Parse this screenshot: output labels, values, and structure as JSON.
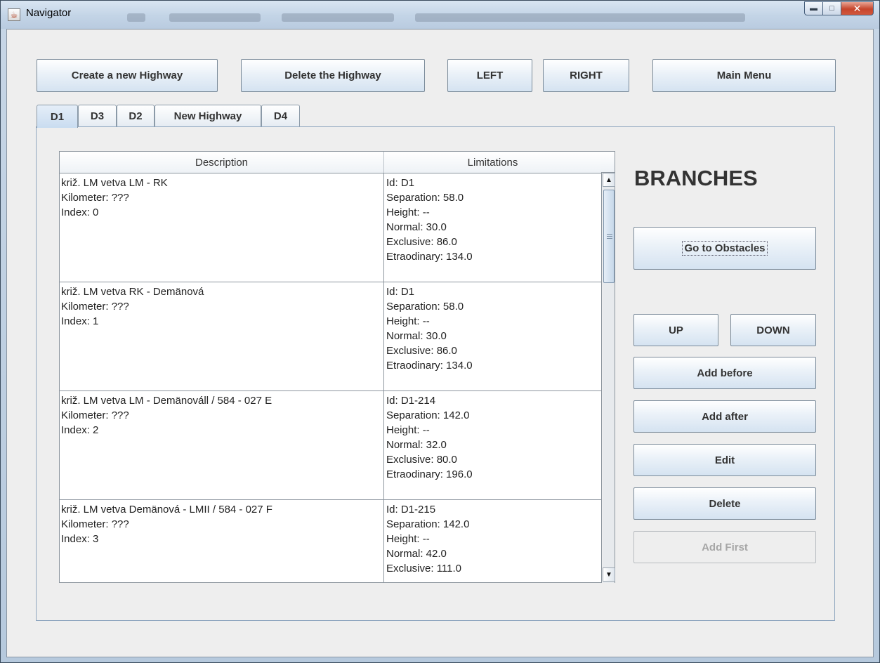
{
  "window": {
    "title": "Navigator"
  },
  "toolbar": {
    "create_label": "Create a new Highway",
    "delete_label": "Delete the Highway",
    "left_label": "LEFT",
    "right_label": "RIGHT",
    "main_menu_label": "Main Menu"
  },
  "tabs": [
    {
      "label": "D1",
      "selected": true
    },
    {
      "label": "D3",
      "selected": false
    },
    {
      "label": "D2",
      "selected": false
    },
    {
      "label": "New Highway",
      "selected": false
    },
    {
      "label": "D4",
      "selected": false
    }
  ],
  "table": {
    "columns": [
      "Description",
      "Limitations"
    ],
    "rows": [
      {
        "description": [
          "križ. LM vetva LM - RK",
          "Kilometer: ???",
          "Index: 0"
        ],
        "limitations": [
          "Id: D1",
          "Separation: 58.0",
          "Height: --",
          "Normal: 30.0",
          "Exclusive: 86.0",
          "Etraodinary: 134.0"
        ]
      },
      {
        "description": [
          "križ. LM vetva RK - Demänová",
          "Kilometer: ???",
          "Index: 1"
        ],
        "limitations": [
          "Id: D1",
          "Separation: 58.0",
          "Height: --",
          "Normal: 30.0",
          "Exclusive: 86.0",
          "Etraodinary: 134.0"
        ]
      },
      {
        "description": [
          "križ. LM vetva LM - Demänováll / 584 - 027 E",
          "Kilometer: ???",
          "Index: 2"
        ],
        "limitations": [
          "Id: D1-214",
          "Separation: 142.0",
          "Height: --",
          "Normal: 32.0",
          "Exclusive: 80.0",
          "Etraodinary: 196.0"
        ]
      },
      {
        "description": [
          "križ. LM vetva Demänová - LMII / 584 - 027 F",
          "Kilometer: ???",
          "Index: 3"
        ],
        "limitations": [
          "Id: D1-215",
          "Separation: 142.0",
          "Height: --",
          "Normal: 42.0",
          "Exclusive: 111.0"
        ]
      }
    ]
  },
  "side_panel": {
    "heading": "BRANCHES",
    "go_to_obstacles_label": "Go to Obstacles",
    "up_label": "UP",
    "down_label": "DOWN",
    "add_before_label": "Add before",
    "add_after_label": "Add after",
    "edit_label": "Edit",
    "delete_label": "Delete",
    "add_first_label": "Add First"
  }
}
